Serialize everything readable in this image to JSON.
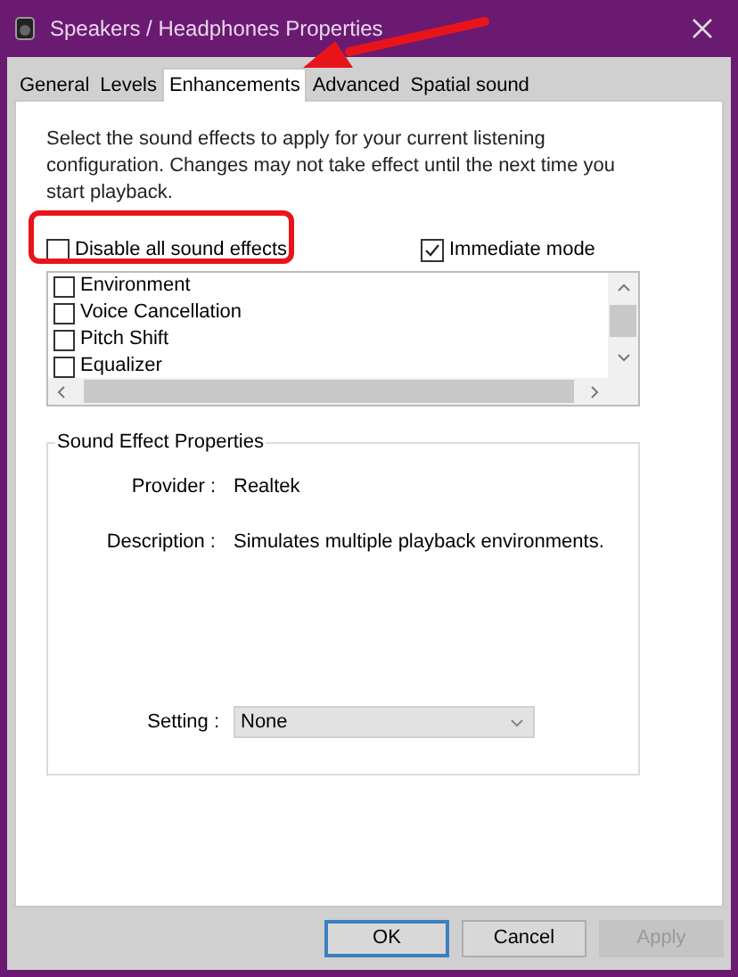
{
  "window": {
    "title": "Speakers / Headphones Properties"
  },
  "tabs": [
    {
      "label": "General",
      "selected": false
    },
    {
      "label": "Levels",
      "selected": false
    },
    {
      "label": "Enhancements",
      "selected": true
    },
    {
      "label": "Advanced",
      "selected": false
    },
    {
      "label": "Spatial sound",
      "selected": false
    }
  ],
  "intro": "Select the sound effects to apply for your current listening configuration. Changes may not take effect until the next time you start playback.",
  "disable_all": {
    "label": "Disable all sound effects",
    "checked": false
  },
  "immediate_mode": {
    "label": "Immediate mode",
    "checked": true
  },
  "effects": [
    {
      "label": "Environment",
      "checked": false
    },
    {
      "label": "Voice Cancellation",
      "checked": false
    },
    {
      "label": "Pitch Shift",
      "checked": false
    },
    {
      "label": "Equalizer",
      "checked": false
    }
  ],
  "properties": {
    "title": "Sound Effect Properties",
    "provider_label": "Provider :",
    "provider": "Realtek",
    "description_label": "Description :",
    "description": "Simulates multiple playback environments.",
    "setting_label": "Setting :",
    "setting": "None"
  },
  "buttons": [
    {
      "label": "OK",
      "disabled": false
    },
    {
      "label": "Cancel",
      "disabled": false
    },
    {
      "label": "Apply",
      "disabled": true
    }
  ]
}
